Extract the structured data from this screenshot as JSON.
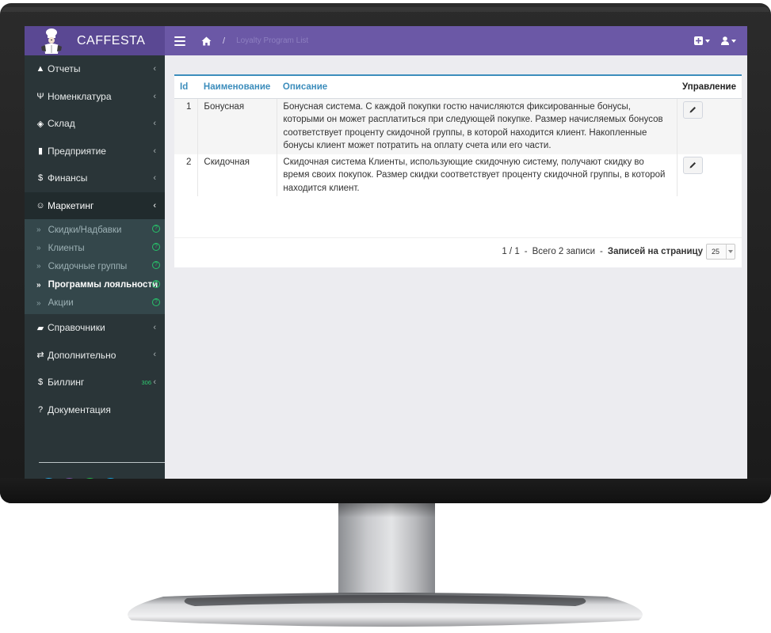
{
  "app": {
    "brand": "CAFFESTA",
    "breadcrumb_sep": "/",
    "breadcrumb_current": "Loyalty Program List",
    "colors": {
      "topbar": "#6b58a6",
      "brand_bg": "#5a4893",
      "sidebar": "#2a3538",
      "accent": "#3c8dbc",
      "badge": "#2ecc71"
    }
  },
  "sidebar": {
    "items": [
      {
        "label": "Отчеты",
        "icon": "chart-area-icon",
        "glyph": "▲"
      },
      {
        "label": "Номенклатура",
        "icon": "cutlery-icon",
        "glyph": "Ψ"
      },
      {
        "label": "Склад",
        "icon": "cubes-icon",
        "glyph": "◈"
      },
      {
        "label": "Предприятие",
        "icon": "building-icon",
        "glyph": "▮"
      },
      {
        "label": "Финансы",
        "icon": "dollar-icon",
        "glyph": "$"
      },
      {
        "label": "Маркетинг",
        "icon": "smile-icon",
        "glyph": "☺"
      },
      {
        "label": "Справочники",
        "icon": "book-icon",
        "glyph": "▰"
      },
      {
        "label": "Дополнительно",
        "icon": "exchange-icon",
        "glyph": "⇄"
      },
      {
        "label": "Биллинг",
        "icon": "dollar-icon",
        "glyph": "$",
        "badge": "306"
      },
      {
        "label": "Документация",
        "icon": "question-icon",
        "glyph": "?"
      }
    ],
    "submenu": [
      {
        "label": "Скидки/Надбавки"
      },
      {
        "label": "Клиенты"
      },
      {
        "label": "Скидочные группы"
      },
      {
        "label": "Программы лояльности"
      },
      {
        "label": "Акции"
      }
    ],
    "chevron": "‹",
    "subprefix": "»",
    "help": "?"
  },
  "table": {
    "headers": {
      "id": "Id",
      "name": "Наименование",
      "description": "Описание",
      "actions": "Управление"
    },
    "rows": [
      {
        "id": "1",
        "name": "Бонусная",
        "description": "Бонусная система. С каждой покупки гостю начисляются фиксированные бонусы, которыми он может расплатиться при следующей покупке. Размер начисляемых бонусов соответствует проценту скидочной группы, в которой находится клиент. Накопленные бонусы клиент может потратить на оплату счета или его части."
      },
      {
        "id": "2",
        "name": "Скидочная",
        "description": "Скидочная система Клиенты, использующие скидочную систему, получают скидку во время своих покупок. Размер скидки соответствует проценту скидочной группы, в которой находится клиент."
      }
    ]
  },
  "pager": {
    "pages": "1 / 1",
    "dash": "-",
    "total": "Всего 2 записи",
    "per_page_label": "Записей на страницу",
    "per_page_value": "25"
  }
}
